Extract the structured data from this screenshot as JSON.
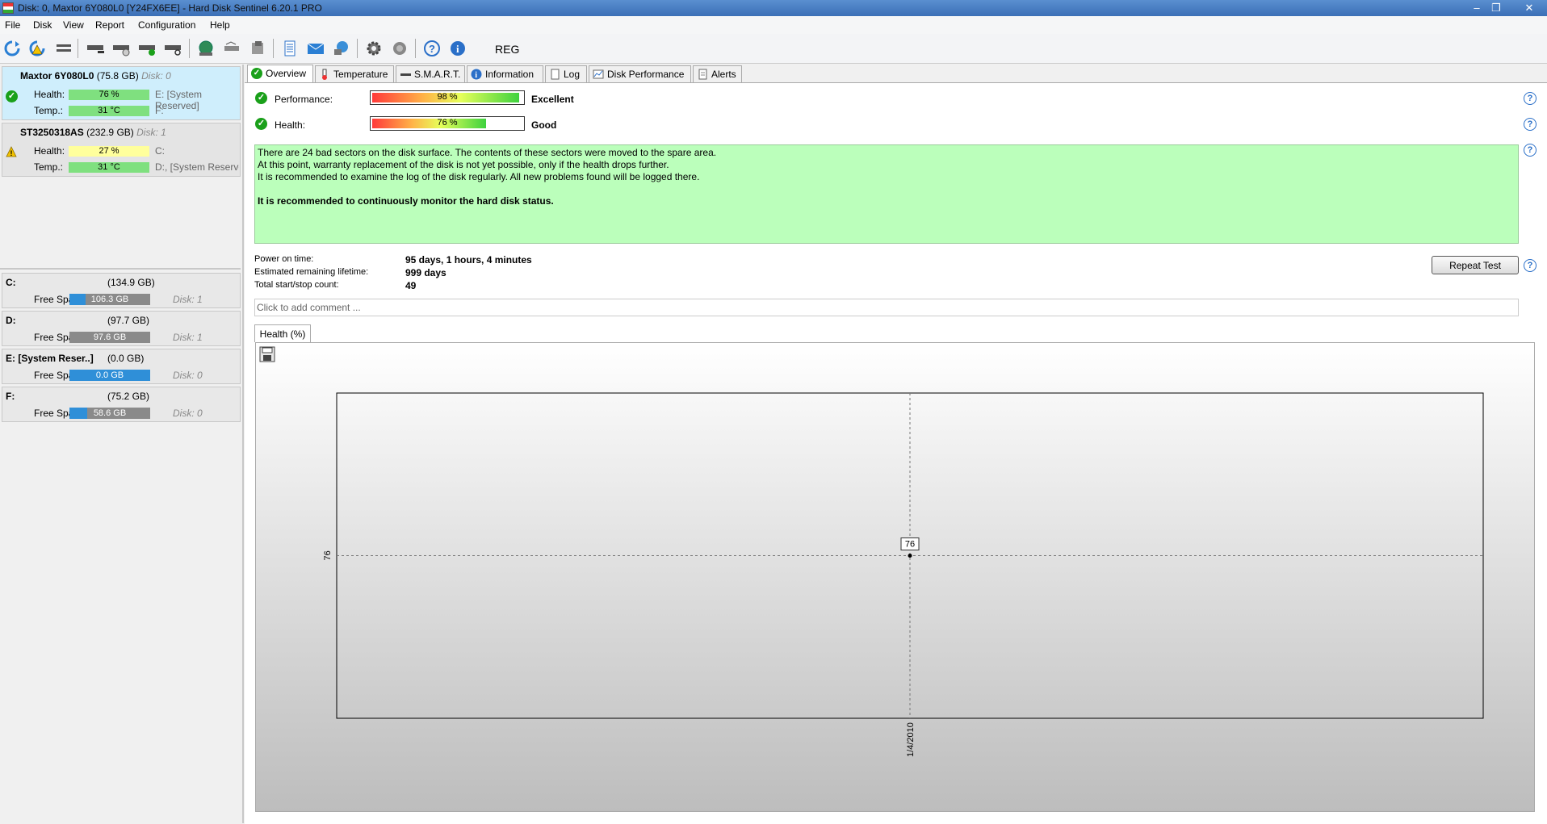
{
  "window": {
    "title": "Disk: 0, Maxtor 6Y080L0 [Y24FX6EE]  -  Hard Disk Sentinel 6.20.1 PRO",
    "controls": [
      "minimize",
      "restore",
      "close"
    ]
  },
  "menu": [
    "File",
    "Disk",
    "View",
    "Report",
    "Configuration",
    "Help"
  ],
  "toolbar": {
    "reg_label": "REG"
  },
  "disks": [
    {
      "name": "Maxtor 6Y080L0",
      "size": "(75.8 GB)",
      "disk": "Disk: 0",
      "health_label": "Health:",
      "health": "76 %",
      "health_value": 76,
      "temp_label": "Temp.:",
      "temp": "31 °C",
      "vol1": "E: [System Reserved]",
      "vol2": "F:",
      "status": "ok"
    },
    {
      "name": "ST3250318AS",
      "size": "(232.9 GB)",
      "disk": "Disk: 1",
      "health_label": "Health:",
      "health": "27 %",
      "health_value": 27,
      "temp_label": "Temp.:",
      "temp": "31 °C",
      "vol1": "C:",
      "vol2": "D:, [System Reserve",
      "status": "warning"
    }
  ],
  "volumes": [
    {
      "name": "C:",
      "size": "(134.9 GB)",
      "free_label": "Free Space",
      "free": "106.3 GB",
      "free_fraction": 0.0,
      "disk": "Disk: 1"
    },
    {
      "name": "D:",
      "size": "(97.7 GB)",
      "free_label": "Free Space",
      "free": "97.6 GB",
      "free_fraction": 0.0,
      "disk": "Disk: 1"
    },
    {
      "name": "E: [System Reser..]",
      "size": "(0.0 GB)",
      "free_label": "Free Space",
      "free": "0.0 GB",
      "free_fraction": 1.0,
      "disk": "Disk: 0"
    },
    {
      "name": "F:",
      "size": "(75.2 GB)",
      "free_label": "Free Space",
      "free": "58.6 GB",
      "free_fraction": 0.22,
      "disk": "Disk: 0"
    }
  ],
  "tabs": [
    "Overview",
    "Temperature",
    "S.M.A.R.T.",
    "Information",
    "Log",
    "Disk Performance",
    "Alerts"
  ],
  "overview": {
    "performance_label": "Performance:",
    "performance": "98 %",
    "performance_value": 98,
    "performance_rating": "Excellent",
    "health_label": "Health:",
    "health": "76 %",
    "health_value": 76,
    "health_rating": "Good",
    "message": [
      "There are 24 bad sectors on the disk surface. The contents of these sectors were moved to the spare area.",
      "At this point, warranty replacement of the disk is not yet possible, only if the health drops further.",
      "It is recommended to examine the log of the disk regularly. All new problems found will be logged there.",
      "",
      "It is recommended to continuously monitor the hard disk status."
    ],
    "stats": [
      {
        "label": "Power on time:",
        "value": "95 days, 1 hours, 4 minutes"
      },
      {
        "label": "Estimated remaining lifetime:",
        "value": "999 days"
      },
      {
        "label": "Total start/stop count:",
        "value": "49"
      }
    ],
    "repeat_button": "Repeat Test",
    "comment_placeholder": "Click to add comment ...",
    "chart_tab": "Health (%)"
  },
  "chart_data": {
    "type": "line",
    "x": [
      "1/4/2010"
    ],
    "series": [
      {
        "values": [
          76
        ]
      }
    ],
    "ytick": "76",
    "point_label": "76"
  },
  "colors": {
    "ok": "#1aa01a",
    "warning": "#f2c200",
    "message_bg": "#bbffbb",
    "health_bar": "#7fe07f"
  }
}
